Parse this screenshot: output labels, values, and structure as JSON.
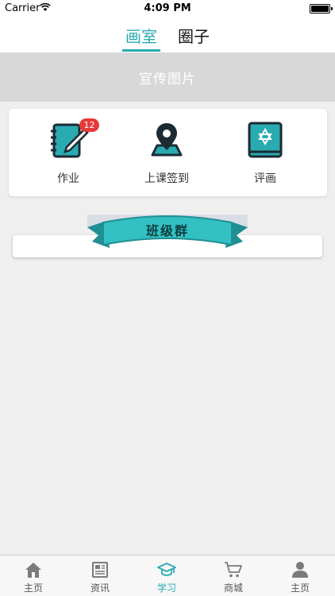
{
  "status": {
    "carrier": "Carrier",
    "time": "4:09 PM"
  },
  "top_tabs": [
    {
      "label": "画室",
      "active": true
    },
    {
      "label": "圈子",
      "active": false
    }
  ],
  "banner": {
    "text": "宣传图片"
  },
  "features": [
    {
      "label": "作业",
      "icon": "notebook-pencil-icon",
      "badge": "12"
    },
    {
      "label": "上课签到",
      "icon": "map-pin-icon"
    },
    {
      "label": "评画",
      "icon": "book-star-icon"
    }
  ],
  "class_group": {
    "title": "班级群"
  },
  "bottom_nav": [
    {
      "label": "主页",
      "icon": "home-icon"
    },
    {
      "label": "资讯",
      "icon": "news-icon"
    },
    {
      "label": "学习",
      "icon": "graduation-cap-icon",
      "active": true
    },
    {
      "label": "商城",
      "icon": "cart-icon"
    },
    {
      "label": "主页",
      "icon": "user-icon"
    }
  ],
  "colors": {
    "accent": "#2aaab1",
    "badge": "#e53a3a",
    "banner_bg": "#d8d8d8",
    "page_bg": "#efefef"
  }
}
